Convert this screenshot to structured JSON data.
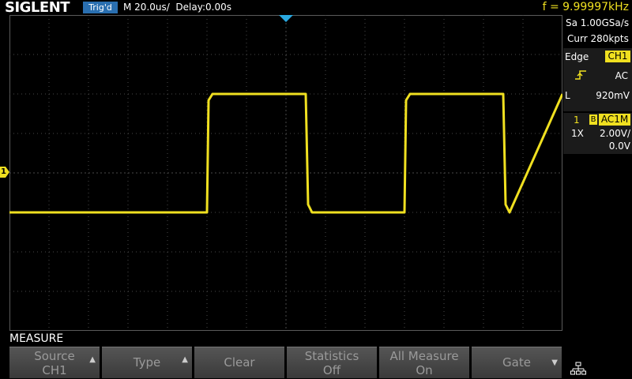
{
  "header": {
    "brand": "SIGLENT",
    "trigger_status": "Trig'd",
    "timebase": "M 20.0us/  Delay:0.00s",
    "frequency": "f = 9.99997kHz"
  },
  "acquisition": {
    "sample_rate": "Sa 1.00GSa/s",
    "memory_depth": "Curr 280kpts"
  },
  "trigger": {
    "type": "Edge",
    "source": "CH1",
    "coupling": "AC",
    "level_prefix": "L",
    "level": "920mV"
  },
  "channel": {
    "number": "1",
    "bw_tag": "B",
    "coupling": "AC1M",
    "probe": "1X",
    "scale": "2.00V/",
    "offset": "0.0V",
    "marker": "1",
    "color": "#f0e020"
  },
  "waveform": {
    "period_us": 100,
    "volts_per_div": 2.0,
    "high_div": 2.0,
    "low_div": -1.0,
    "first_rising_edge_us": -40
  },
  "bottom_menu": {
    "title": "MEASURE",
    "buttons": [
      {
        "line1": "Source",
        "line2": "CH1"
      },
      {
        "line1": "Type",
        "line2": ""
      },
      {
        "line1": "Clear",
        "line2": ""
      },
      {
        "line1": "Statistics",
        "line2": "Off"
      },
      {
        "line1": "All Measure",
        "line2": "On"
      },
      {
        "line1": "Gate",
        "line2": ""
      }
    ]
  },
  "icons": {
    "trigger_position": "trigger-position-marker-icon",
    "trigger_slope": "rising-edge-icon",
    "network": "network-icon",
    "menu_arrow": "arrow-icon"
  }
}
